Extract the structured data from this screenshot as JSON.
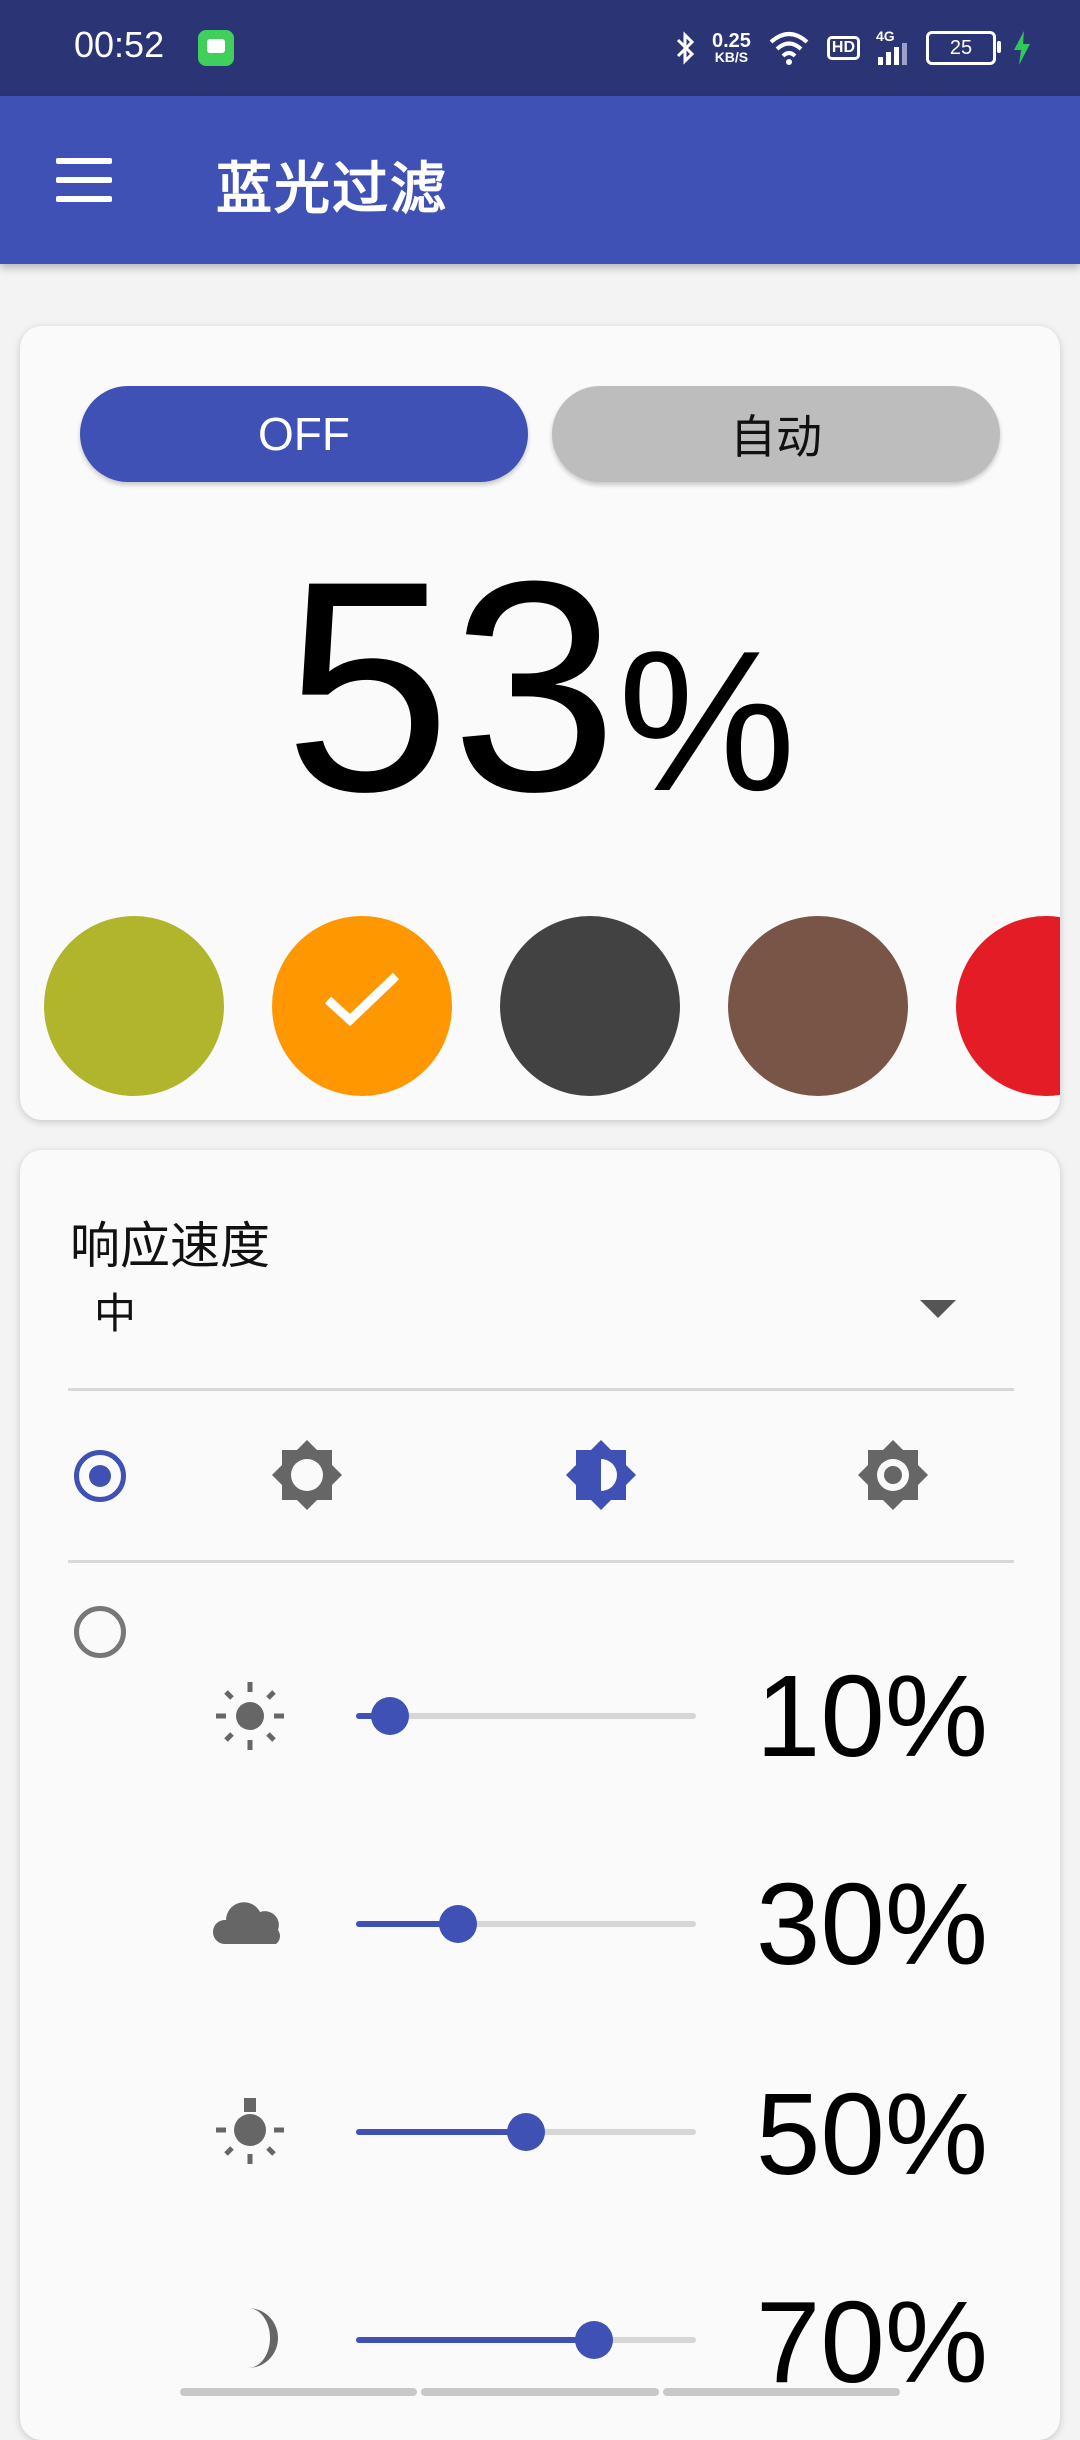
{
  "status_bar": {
    "time": "00:52",
    "net_speed_value": "0.25",
    "net_speed_unit": "KB/S",
    "hd_label": "HD",
    "network_label": "4G",
    "battery_level": "25"
  },
  "app_bar": {
    "title": "蓝光过滤"
  },
  "filter_card": {
    "off_label": "OFF",
    "auto_label": "自动",
    "intensity_value": "53",
    "intensity_unit": "%",
    "colors": [
      "#b0b52c",
      "#ff9800",
      "#424242",
      "#795548",
      "#e31c25"
    ],
    "selected_color_index": 1
  },
  "speed_card": {
    "response_label": "响应速度",
    "response_value": "中",
    "mode_icons": [
      "radio-selected",
      "brightness-low-icon",
      "brightness-medium-icon",
      "brightness-high-icon"
    ],
    "schedule_rows": [
      {
        "icon": "sun-icon",
        "value": 10,
        "label": "10%"
      },
      {
        "icon": "cloud-icon",
        "value": 30,
        "label": "30%"
      },
      {
        "icon": "lamp-icon",
        "value": 50,
        "label": "50%"
      },
      {
        "icon": "moon-icon",
        "value": 70,
        "label": "70%"
      }
    ]
  },
  "accent_color": "#3f51b5"
}
